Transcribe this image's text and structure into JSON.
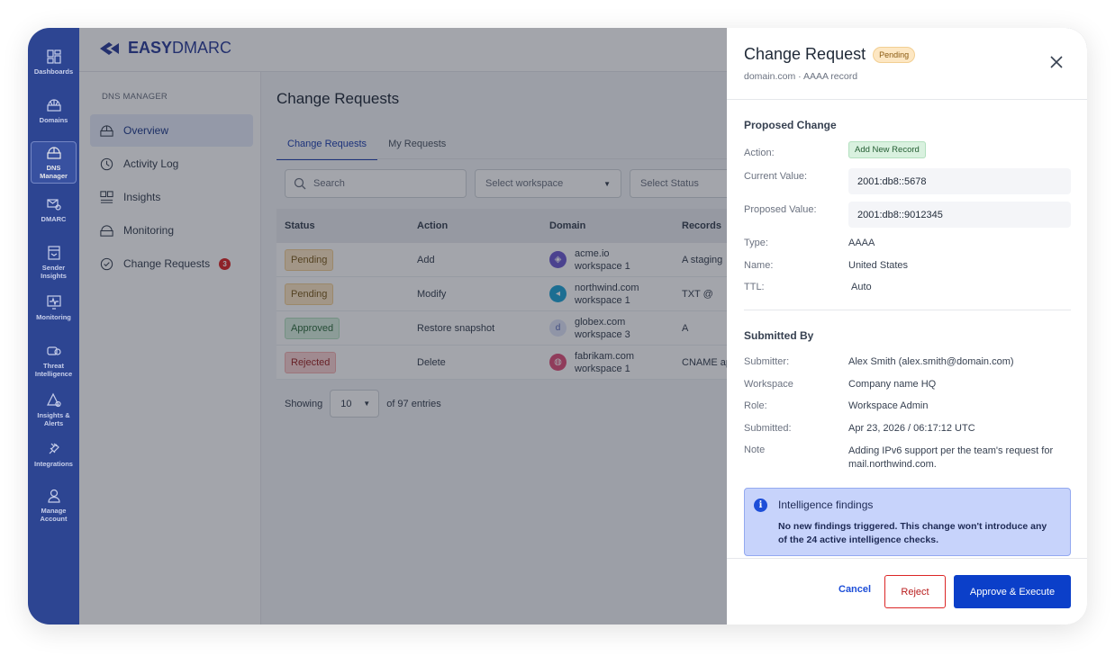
{
  "rail": {
    "items": [
      {
        "label": "Dashboards",
        "icon": "dashboard-icon"
      },
      {
        "label": "Domains",
        "icon": "www-icon"
      },
      {
        "label": "DNS Manager",
        "icon": "dns-icon",
        "active": true
      },
      {
        "label": "DMARC",
        "icon": "mail-gear-icon"
      },
      {
        "label": "Sender Insights",
        "icon": "sender-icon"
      },
      {
        "label": "Monitoring",
        "icon": "monitor-icon"
      },
      {
        "label": "Threat Intelligence",
        "icon": "threat-icon"
      },
      {
        "label": "Insights & Alerts",
        "icon": "alert-icon"
      },
      {
        "label": "Integrations",
        "icon": "plug-icon"
      },
      {
        "label": "Manage Account",
        "icon": "user-icon"
      }
    ]
  },
  "brand": {
    "bold": "EASY",
    "light": "DMARC"
  },
  "subnav": {
    "title": "DNS MANAGER",
    "items": [
      {
        "label": "Overview",
        "active": true
      },
      {
        "label": "Activity Log"
      },
      {
        "label": "Insights"
      },
      {
        "label": "Monitoring"
      },
      {
        "label": "Change Requests",
        "badge": "3"
      }
    ]
  },
  "main": {
    "title": "Change Requests",
    "tabs": [
      "Change Requests",
      "My Requests"
    ],
    "search_placeholder": "Search",
    "workspace_placeholder": "Select workspace",
    "status_placeholder": "Select Status",
    "columns": [
      "Status",
      "Action",
      "Domain",
      "Records"
    ],
    "rows": [
      {
        "status": "Pending",
        "status_kind": "pending",
        "action": "Add",
        "domain": "acme.io",
        "workspace": "workspace 1",
        "records": "A staging",
        "icon_color": "#6d5bd0",
        "icon_glyph": "◈"
      },
      {
        "status": "Pending",
        "status_kind": "pending",
        "action": "Modify",
        "domain": "northwind.com",
        "workspace": "workspace 1",
        "records": "TXT @",
        "icon_color": "#1fa3d6",
        "icon_glyph": "◂"
      },
      {
        "status": "Approved",
        "status_kind": "approved",
        "action": "Restore snapshot",
        "domain": "globex.com",
        "workspace": "workspace 3",
        "records": "A",
        "icon_color": "#dfe4f8",
        "icon_glyph": "d"
      },
      {
        "status": "Rejected",
        "status_kind": "rejected",
        "action": "Delete",
        "domain": "fabrikam.com",
        "workspace": "workspace 1",
        "records": "CNAME ap",
        "icon_color": "#e0507a",
        "icon_glyph": "◍"
      }
    ],
    "showing_label": "Showing",
    "per_page": "10",
    "entries_label": "of 97 entries"
  },
  "drawer": {
    "title": "Change Request",
    "status": "Pending",
    "subtitle": "domain.com · AAAA record",
    "proposed_title": "Proposed Change",
    "action_label": "Action:",
    "action_value": "Add New Record",
    "current_label": "Current Value:",
    "current_value": "2001:db8::5678",
    "proposed_label": "Proposed Value:",
    "proposed_value": "2001:db8::9012345",
    "type_label": "Type:",
    "type_value": "AAAA",
    "name_label": "Name:",
    "name_value": "United States",
    "ttl_label": "TTL:",
    "ttl_value": "Auto",
    "submitted_title": "Submitted By",
    "submitter_label": "Submitter:",
    "submitter_value": "Alex Smith (alex.smith@domain.com)",
    "workspace_label": "Workspace",
    "workspace_value": "Company name HQ",
    "role_label": "Role:",
    "role_value": "Workspace Admin",
    "submitted_label": "Submitted:",
    "submitted_value": "Apr 23, 2026 / 06:17:12 UTC",
    "note_label": "Note",
    "note_value": "Adding IPv6 support per the team's request for mail.northwind.com.",
    "intel_title": "Intelligence findings",
    "intel_body": "No new findings triggered. This change won't introduce any of the 24 active intelligence checks.",
    "cancel": "Cancel",
    "reject": "Reject",
    "approve": "Approve & Execute"
  },
  "colors": {
    "rail": "#2f4a9e",
    "primary": "#0b3fc9",
    "reject": "#dc2626"
  }
}
